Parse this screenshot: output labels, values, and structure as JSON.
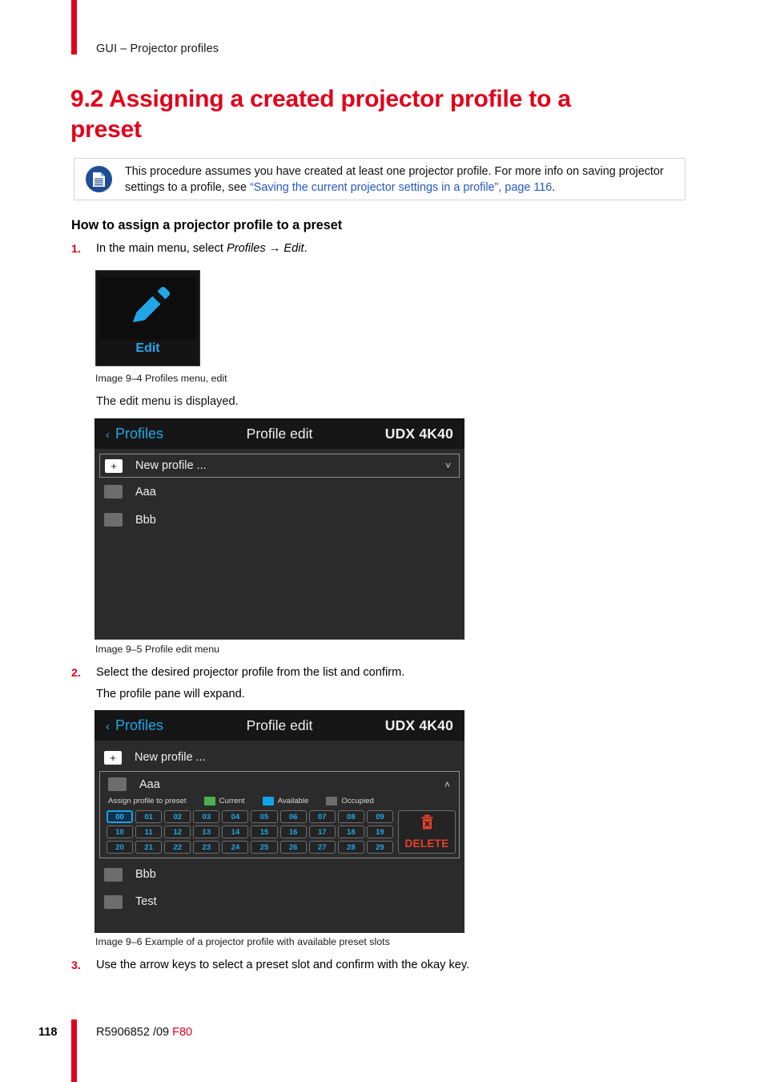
{
  "page": {
    "running_head": "GUI – Projector profiles",
    "chapter_title": "9.2 Assigning a created projector profile to a preset",
    "page_number": "118",
    "footer_code": "R5906852 /09",
    "footer_product": "F80",
    "accent_red": "#e2001a",
    "link_blue": "#2559c4"
  },
  "note": {
    "icon": "document-note-icon",
    "text_before": "This procedure assumes you have created at least one projector profile. For more info on saving projector settings to a profile, see ",
    "link_text": "“Saving the current projector settings in a profile”, page 116",
    "text_after": "."
  },
  "sub_heading": "How to assign a projector profile to a preset",
  "steps": [
    {
      "num": "1.",
      "text_plain": "In the main menu, select ",
      "text_italic_a": "Profiles",
      "arrow": " → ",
      "text_italic_b": "Edit",
      "text_end": "."
    },
    {
      "num": "2.",
      "text": "Select the desired projector profile from the list and confirm.",
      "follow_up": "The profile pane will expand."
    },
    {
      "num": "3.",
      "text": "Use the arrow keys to select a preset slot and confirm with the okay key."
    }
  ],
  "after_fig1_text": "The edit menu is displayed.",
  "captions": {
    "fig_9_4": "Image 9–4  Profiles menu, edit",
    "fig_9_5": "Image 9–5  Profile edit menu",
    "fig_9_6": "Image 9–6  Example of a projector profile with available preset slots"
  },
  "edit_tile": {
    "icon": "pencil-edit-icon",
    "label": "Edit",
    "label_color": "#21a7e8"
  },
  "gui_screen_1": {
    "back_label": "Profiles",
    "title": "Profile edit",
    "model": "UDX 4K40",
    "new_profile_label": "New profile ...",
    "plus_glyph": "+",
    "profiles": [
      "Aaa",
      "Bbb"
    ]
  },
  "gui_screen_2": {
    "back_label": "Profiles",
    "title": "Profile edit",
    "model": "UDX 4K40",
    "new_profile_label": "New profile ...",
    "plus_glyph": "+",
    "expanded_profile": "Aaa",
    "assign_label": "Assign profile to preset",
    "legend": [
      {
        "label": "Current",
        "color": "#4caf50"
      },
      {
        "label": "Available",
        "color": "#13a3e8"
      },
      {
        "label": "Occupied",
        "color": "#6d6d6d"
      }
    ],
    "preset_slots": [
      "00",
      "01",
      "02",
      "03",
      "04",
      "05",
      "06",
      "07",
      "08",
      "09",
      "10",
      "11",
      "12",
      "13",
      "14",
      "15",
      "16",
      "17",
      "18",
      "19",
      "20",
      "21",
      "22",
      "23",
      "24",
      "25",
      "26",
      "27",
      "28",
      "29"
    ],
    "selected_slot": "00",
    "delete_label": "DELETE",
    "delete_icon": "trash-delete-icon",
    "other_profiles": [
      "Bbb",
      "Test"
    ]
  }
}
